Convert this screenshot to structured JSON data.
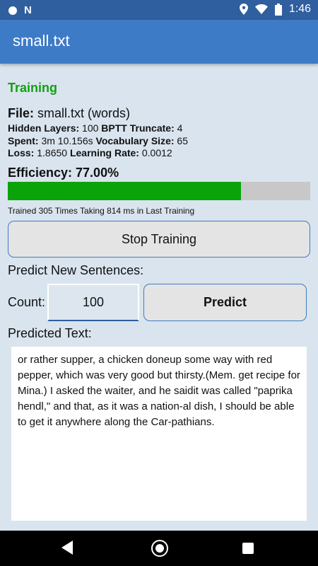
{
  "status_bar": {
    "time": "1:46",
    "left_icons": [
      "notification-dot-icon",
      "n-notification-icon"
    ],
    "right_icons": [
      "location-icon",
      "wifi-icon",
      "battery-icon"
    ]
  },
  "app_bar": {
    "title": "small.txt"
  },
  "training": {
    "status": "Training",
    "file_label": "File:",
    "file_value": "small.txt (words)",
    "hidden_layers_label": "Hidden Layers:",
    "hidden_layers_value": "100",
    "bptt_label": "BPTT Truncate:",
    "bptt_value": "4",
    "spent_label": "Spent:",
    "spent_value": "3m 10.156s",
    "vocab_label": "Vocabulary Size:",
    "vocab_value": "65",
    "loss_label": "Loss:",
    "loss_value": "1.8650",
    "lr_label": "Learning Rate:",
    "lr_value": "0.0012",
    "efficiency_text": "Efficiency: 77.00%",
    "efficiency_fraction": 0.77,
    "trained_text": "Trained 305 Times Taking 814 ms in Last Training",
    "stop_button": "Stop Training"
  },
  "predict": {
    "heading": "Predict New Sentences:",
    "count_label": "Count:",
    "count_value": "100",
    "predict_button": "Predict",
    "predicted_label": "Predicted Text:",
    "predicted_text": "or rather supper, a chicken doneup some way with red pepper, which was very good but thirsty.(Mem. get recipe for Mina.) I asked the waiter, and he saidit was called \"paprika hendl,\" and that, as it was a nation-al dish, I should be able to get it anywhere along the Car-pathians."
  },
  "colors": {
    "accent": "#3e7bc7",
    "status_bar": "#2f5f9e",
    "training_green": "#12a012",
    "progress_fill": "#0aa40a"
  }
}
